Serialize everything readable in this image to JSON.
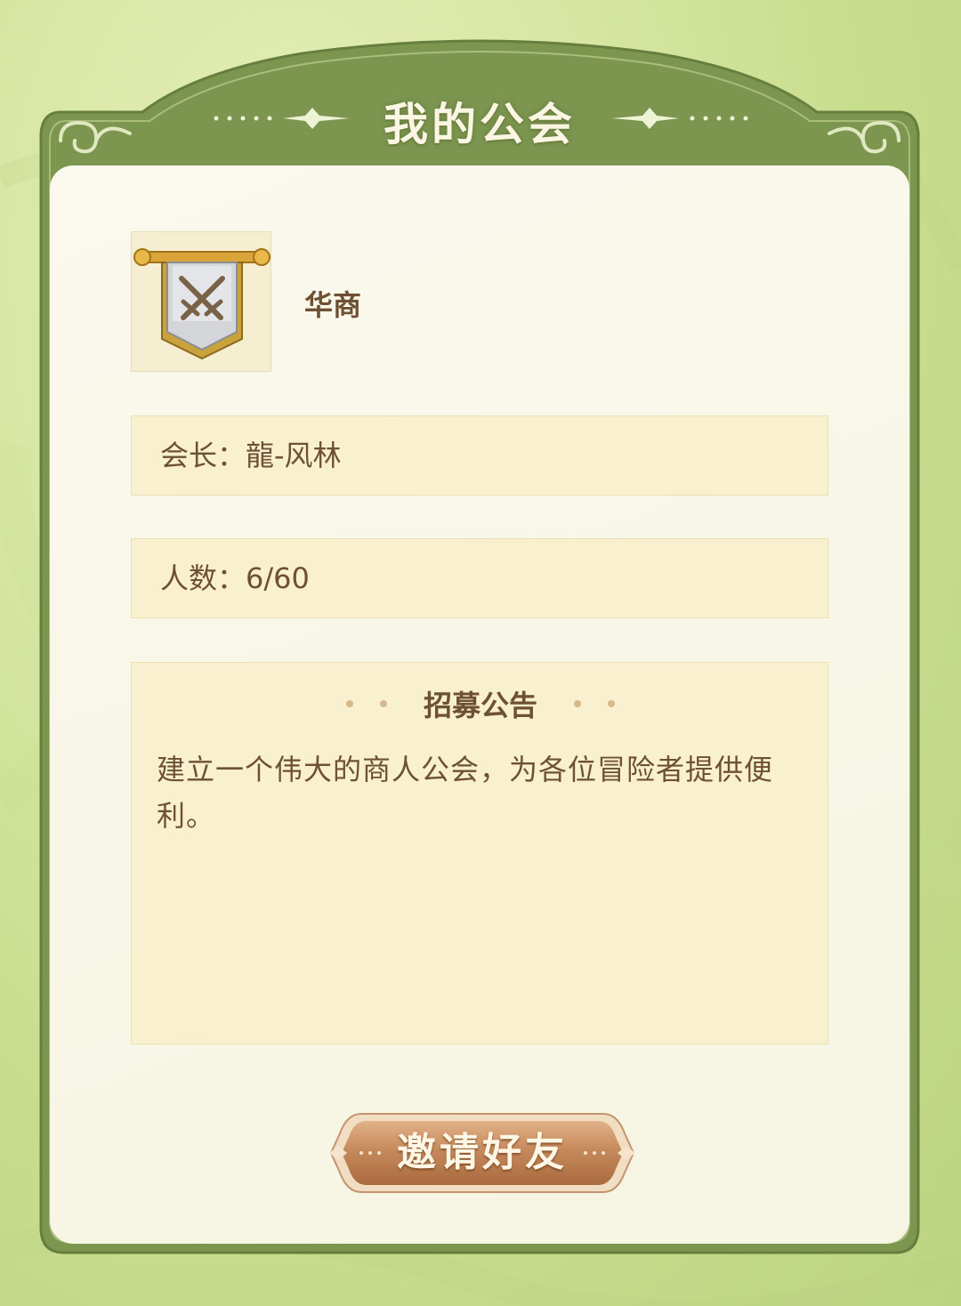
{
  "title": "我的公会",
  "guild": {
    "name": "华商",
    "icon": "crossed-swords-banner-icon"
  },
  "leader": {
    "label": "会长：龍-风林"
  },
  "members": {
    "label": "人数：6/60"
  },
  "notice": {
    "title": "招募公告",
    "text": "建立一个伟大的商人公会，为各位冒险者提供便利。"
  },
  "invite_button": {
    "label": "邀请好友"
  },
  "colors": {
    "frame_green": "#7c9650",
    "panel_bg": "#fbf9ee",
    "row_bg": "#f9f0cf",
    "text_brown": "#6e5034",
    "button_bronze": "#b87a4e"
  }
}
